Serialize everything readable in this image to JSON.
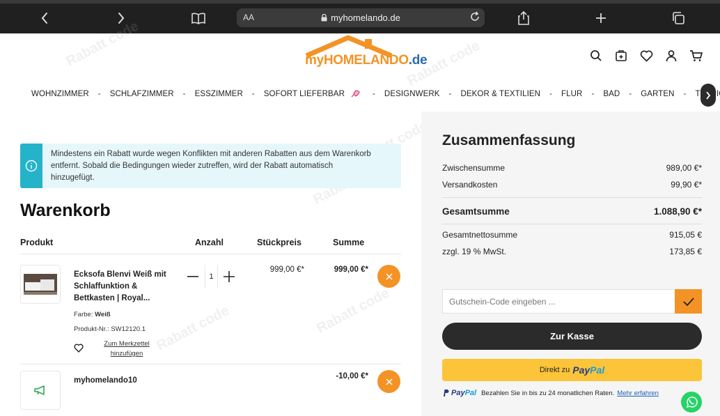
{
  "browser": {
    "text_size_label": "AA",
    "url": "myhomelando.de"
  },
  "logo": {
    "part1": "my",
    "part2": "HOMELANDO",
    "part3": ".de"
  },
  "nav": {
    "items": [
      "WOHNZIMMER",
      "SCHLAFZIMMER",
      "ESSZIMMER",
      "SOFORT LIEFERBAR",
      "DESIGNWERK",
      "DEKOR & TEXTILIEN",
      "FLUR",
      "BAD",
      "GARTEN",
      "TEPPICH"
    ],
    "separator": "-"
  },
  "alert": {
    "message": "Mindestens ein Rabatt wurde wegen Konflikten mit anderen Rabatten aus dem Warenkorb entfernt. Sobald die Bedingungen wieder zutreffen, wird der Rabatt automatisch hinzugefügt."
  },
  "cart": {
    "title": "Warenkorb",
    "headers": {
      "product": "Produkt",
      "quantity": "Anzahl",
      "unit_price": "Stückpreis",
      "total": "Summe"
    },
    "item": {
      "name": "Ecksofa Blenvi Weiß mit Schlaffunktion & Bettkasten | Royal...",
      "color_label": "Farbe:",
      "color_value": "Weiß",
      "sku_label": "Produkt-Nr.:",
      "sku_value": "SW12120.1",
      "wishlist_label": "Zum Merkzettel hinzufügen",
      "quantity": "1",
      "unit_price": "999,00 €*",
      "total": "999,00 €*"
    },
    "promo": {
      "code": "myhomelando10",
      "amount": "-10,00 €*"
    }
  },
  "summary": {
    "title": "Zusammenfassung",
    "subtotal_label": "Zwischensumme",
    "subtotal_value": "989,00 €*",
    "shipping_label": "Versandkosten",
    "shipping_value": "99,90 €*",
    "total_label": "Gesamtsumme",
    "total_value": "1.088,90 €*",
    "net_label": "Gesamtnettosumme",
    "net_value": "915,05 €",
    "vat_label": "zzgl. 19 % MwSt.",
    "vat_value": "173,85 €",
    "voucher_placeholder": "Gutschein-Code eingeben ...",
    "checkout_label": "Zur Kasse",
    "paypal_prefix": "Direkt zu",
    "paypal_pay": "Pay",
    "paypal_pal": "Pal",
    "paypal_note": "Bezahlen Sie in bis zu 24 monatlichen Raten.",
    "paypal_more": "Mehr erfahren"
  },
  "colors": {
    "accent": "#f39325",
    "info": "#25b3c9",
    "dark": "#2b2b2b",
    "paypal_yellow": "#fcc439"
  }
}
